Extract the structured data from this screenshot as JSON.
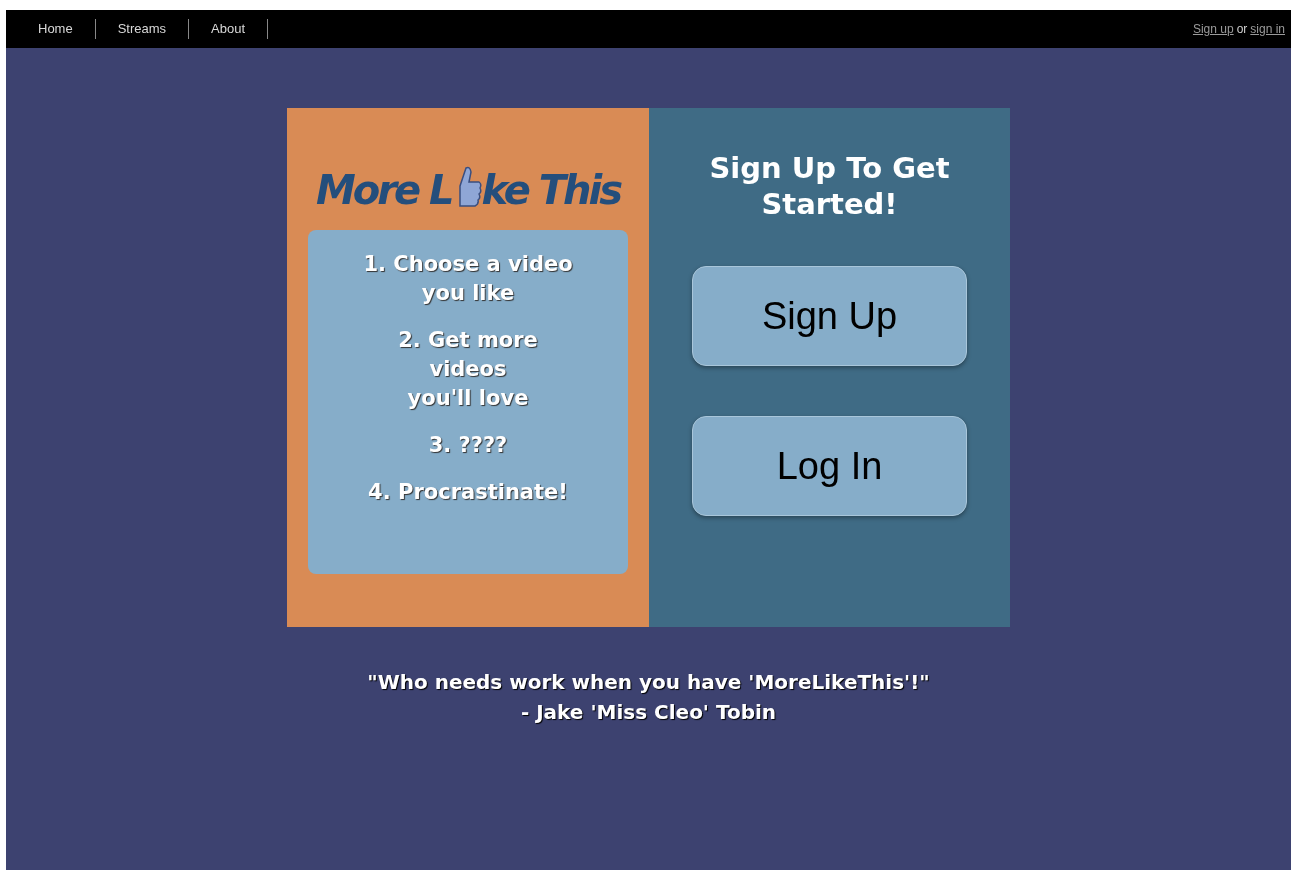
{
  "nav": {
    "links": [
      {
        "label": "Home"
      },
      {
        "label": "Streams"
      },
      {
        "label": "About"
      }
    ],
    "auth": {
      "signup": "Sign up",
      "or": "or",
      "signin": "sign in"
    }
  },
  "logo": {
    "before": "More L",
    "after": "ke This"
  },
  "steps": [
    "1. Choose a video\nyou like",
    "2. Get more\nvideos\nyou'll love",
    "3. ????",
    "4. Procrastinate!"
  ],
  "signup_panel": {
    "heading": "Sign Up To Get Started!",
    "buttons": [
      "Sign Up",
      "Log In"
    ]
  },
  "quote": {
    "text": "\"Who needs work when you have 'MoreLikeThis'!\"",
    "author": "- Jake 'Miss Cleo' Tobin"
  }
}
